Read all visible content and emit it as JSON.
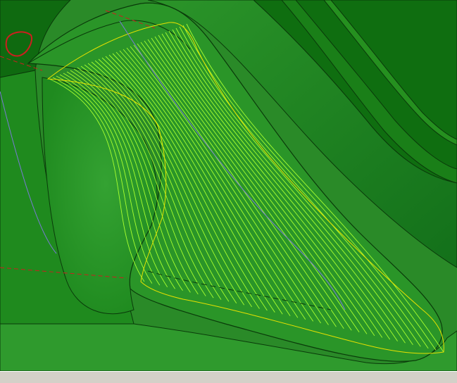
{
  "viewport": {
    "background": "#2a8a28",
    "surface_light": "#2f9a2d",
    "surface_mid": "#228a22",
    "surface_dark": "#0e6a0e",
    "toolpath_color": "#a8ff30",
    "toolpath_edge_color": "#e6e000",
    "annotation_color": "#cc1f1f",
    "edge_color": "#0a3a0a",
    "axis_line_color": "#7a7ad8",
    "toolpath_count": 40
  },
  "statusbar": {
    "background": "#d4d0c8"
  }
}
